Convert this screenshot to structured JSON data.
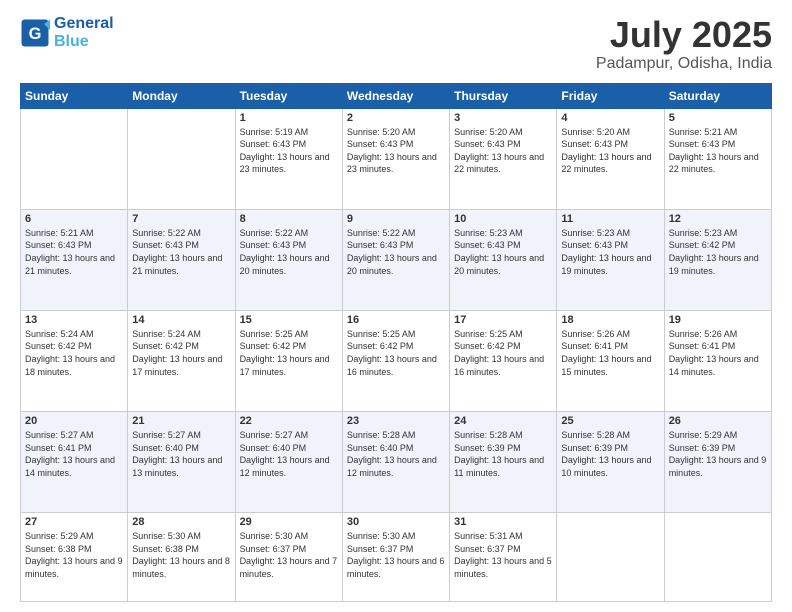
{
  "logo": {
    "line1": "General",
    "line2": "Blue"
  },
  "title": "July 2025",
  "subtitle": "Padampur, Odisha, India",
  "days_of_week": [
    "Sunday",
    "Monday",
    "Tuesday",
    "Wednesday",
    "Thursday",
    "Friday",
    "Saturday"
  ],
  "weeks": [
    [
      {
        "num": "",
        "sunrise": "",
        "sunset": "",
        "daylight": ""
      },
      {
        "num": "",
        "sunrise": "",
        "sunset": "",
        "daylight": ""
      },
      {
        "num": "1",
        "sunrise": "Sunrise: 5:19 AM",
        "sunset": "Sunset: 6:43 PM",
        "daylight": "Daylight: 13 hours and 23 minutes."
      },
      {
        "num": "2",
        "sunrise": "Sunrise: 5:20 AM",
        "sunset": "Sunset: 6:43 PM",
        "daylight": "Daylight: 13 hours and 23 minutes."
      },
      {
        "num": "3",
        "sunrise": "Sunrise: 5:20 AM",
        "sunset": "Sunset: 6:43 PM",
        "daylight": "Daylight: 13 hours and 22 minutes."
      },
      {
        "num": "4",
        "sunrise": "Sunrise: 5:20 AM",
        "sunset": "Sunset: 6:43 PM",
        "daylight": "Daylight: 13 hours and 22 minutes."
      },
      {
        "num": "5",
        "sunrise": "Sunrise: 5:21 AM",
        "sunset": "Sunset: 6:43 PM",
        "daylight": "Daylight: 13 hours and 22 minutes."
      }
    ],
    [
      {
        "num": "6",
        "sunrise": "Sunrise: 5:21 AM",
        "sunset": "Sunset: 6:43 PM",
        "daylight": "Daylight: 13 hours and 21 minutes."
      },
      {
        "num": "7",
        "sunrise": "Sunrise: 5:22 AM",
        "sunset": "Sunset: 6:43 PM",
        "daylight": "Daylight: 13 hours and 21 minutes."
      },
      {
        "num": "8",
        "sunrise": "Sunrise: 5:22 AM",
        "sunset": "Sunset: 6:43 PM",
        "daylight": "Daylight: 13 hours and 20 minutes."
      },
      {
        "num": "9",
        "sunrise": "Sunrise: 5:22 AM",
        "sunset": "Sunset: 6:43 PM",
        "daylight": "Daylight: 13 hours and 20 minutes."
      },
      {
        "num": "10",
        "sunrise": "Sunrise: 5:23 AM",
        "sunset": "Sunset: 6:43 PM",
        "daylight": "Daylight: 13 hours and 20 minutes."
      },
      {
        "num": "11",
        "sunrise": "Sunrise: 5:23 AM",
        "sunset": "Sunset: 6:43 PM",
        "daylight": "Daylight: 13 hours and 19 minutes."
      },
      {
        "num": "12",
        "sunrise": "Sunrise: 5:23 AM",
        "sunset": "Sunset: 6:42 PM",
        "daylight": "Daylight: 13 hours and 19 minutes."
      }
    ],
    [
      {
        "num": "13",
        "sunrise": "Sunrise: 5:24 AM",
        "sunset": "Sunset: 6:42 PM",
        "daylight": "Daylight: 13 hours and 18 minutes."
      },
      {
        "num": "14",
        "sunrise": "Sunrise: 5:24 AM",
        "sunset": "Sunset: 6:42 PM",
        "daylight": "Daylight: 13 hours and 17 minutes."
      },
      {
        "num": "15",
        "sunrise": "Sunrise: 5:25 AM",
        "sunset": "Sunset: 6:42 PM",
        "daylight": "Daylight: 13 hours and 17 minutes."
      },
      {
        "num": "16",
        "sunrise": "Sunrise: 5:25 AM",
        "sunset": "Sunset: 6:42 PM",
        "daylight": "Daylight: 13 hours and 16 minutes."
      },
      {
        "num": "17",
        "sunrise": "Sunrise: 5:25 AM",
        "sunset": "Sunset: 6:42 PM",
        "daylight": "Daylight: 13 hours and 16 minutes."
      },
      {
        "num": "18",
        "sunrise": "Sunrise: 5:26 AM",
        "sunset": "Sunset: 6:41 PM",
        "daylight": "Daylight: 13 hours and 15 minutes."
      },
      {
        "num": "19",
        "sunrise": "Sunrise: 5:26 AM",
        "sunset": "Sunset: 6:41 PM",
        "daylight": "Daylight: 13 hours and 14 minutes."
      }
    ],
    [
      {
        "num": "20",
        "sunrise": "Sunrise: 5:27 AM",
        "sunset": "Sunset: 6:41 PM",
        "daylight": "Daylight: 13 hours and 14 minutes."
      },
      {
        "num": "21",
        "sunrise": "Sunrise: 5:27 AM",
        "sunset": "Sunset: 6:40 PM",
        "daylight": "Daylight: 13 hours and 13 minutes."
      },
      {
        "num": "22",
        "sunrise": "Sunrise: 5:27 AM",
        "sunset": "Sunset: 6:40 PM",
        "daylight": "Daylight: 13 hours and 12 minutes."
      },
      {
        "num": "23",
        "sunrise": "Sunrise: 5:28 AM",
        "sunset": "Sunset: 6:40 PM",
        "daylight": "Daylight: 13 hours and 12 minutes."
      },
      {
        "num": "24",
        "sunrise": "Sunrise: 5:28 AM",
        "sunset": "Sunset: 6:39 PM",
        "daylight": "Daylight: 13 hours and 11 minutes."
      },
      {
        "num": "25",
        "sunrise": "Sunrise: 5:28 AM",
        "sunset": "Sunset: 6:39 PM",
        "daylight": "Daylight: 13 hours and 10 minutes."
      },
      {
        "num": "26",
        "sunrise": "Sunrise: 5:29 AM",
        "sunset": "Sunset: 6:39 PM",
        "daylight": "Daylight: 13 hours and 9 minutes."
      }
    ],
    [
      {
        "num": "27",
        "sunrise": "Sunrise: 5:29 AM",
        "sunset": "Sunset: 6:38 PM",
        "daylight": "Daylight: 13 hours and 9 minutes."
      },
      {
        "num": "28",
        "sunrise": "Sunrise: 5:30 AM",
        "sunset": "Sunset: 6:38 PM",
        "daylight": "Daylight: 13 hours and 8 minutes."
      },
      {
        "num": "29",
        "sunrise": "Sunrise: 5:30 AM",
        "sunset": "Sunset: 6:37 PM",
        "daylight": "Daylight: 13 hours and 7 minutes."
      },
      {
        "num": "30",
        "sunrise": "Sunrise: 5:30 AM",
        "sunset": "Sunset: 6:37 PM",
        "daylight": "Daylight: 13 hours and 6 minutes."
      },
      {
        "num": "31",
        "sunrise": "Sunrise: 5:31 AM",
        "sunset": "Sunset: 6:37 PM",
        "daylight": "Daylight: 13 hours and 5 minutes."
      },
      {
        "num": "",
        "sunrise": "",
        "sunset": "",
        "daylight": ""
      },
      {
        "num": "",
        "sunrise": "",
        "sunset": "",
        "daylight": ""
      }
    ]
  ]
}
